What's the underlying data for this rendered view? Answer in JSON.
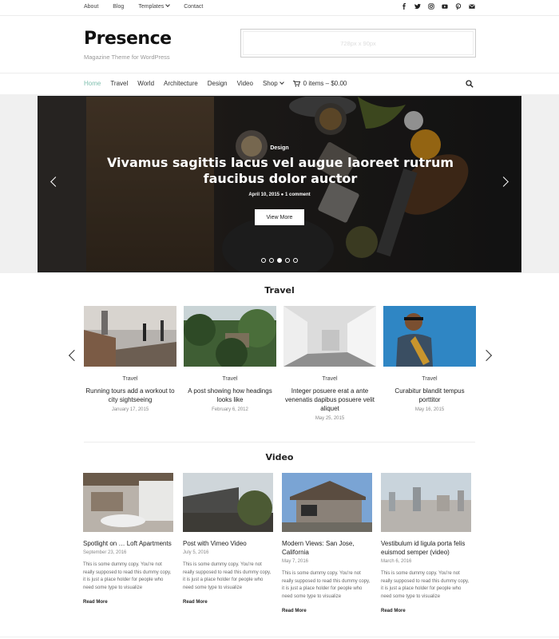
{
  "topbar": {
    "links": [
      "About",
      "Blog",
      "Templates",
      "Contact"
    ],
    "social_icons": [
      "facebook-icon",
      "twitter-icon",
      "instagram-icon",
      "youtube-icon",
      "pinterest-icon",
      "email-icon"
    ]
  },
  "header": {
    "logo": "Presence",
    "tagline": "Magazine Theme for WordPress",
    "ad_text": "728px x 90px"
  },
  "nav": {
    "items": [
      "Home",
      "Travel",
      "World",
      "Architecture",
      "Design",
      "Video",
      "Shop"
    ],
    "active": "Home",
    "cart": "0 items – $0.00"
  },
  "hero": {
    "category": "Design",
    "title": "Vivamus sagittis lacus vel augue laoreet rutrum faucibus dolor auctor",
    "meta": "April 10, 2015  ●  1 comment",
    "button": "View More",
    "slides_total": 5,
    "slide_active": 3
  },
  "travel": {
    "heading": "Travel",
    "cards": [
      {
        "category": "Travel",
        "title": "Running tours add a workout to city sightseeing",
        "date": "January 17, 2015"
      },
      {
        "category": "Travel",
        "title": "A post showing how headings looks like",
        "date": "February 6, 2012"
      },
      {
        "category": "Travel",
        "title": "Integer posuere erat a ante venenatis dapibus posuere velit aliquet",
        "date": "May 25, 2015"
      },
      {
        "category": "Travel",
        "title": "Curabitur blandit tempus porttitor",
        "date": "May 16, 2015"
      }
    ]
  },
  "video": {
    "heading": "Video",
    "cards": [
      {
        "title": "Spotlight on … Loft Apartments",
        "date": "September 23, 2016",
        "excerpt": "This is some dummy copy. You're not really supposed to read this dummy copy, it is just a place holder for people who need some type to visualize",
        "more": "Read More"
      },
      {
        "title": "Post with Vimeo Video",
        "date": "July 5, 2016",
        "excerpt": "This is some dummy copy. You're not really supposed to read this dummy copy, it is just a place holder for people who need some type to visualize",
        "more": "Read More"
      },
      {
        "title": "Modern Views: San Jose, California",
        "date": "May 7, 2016",
        "excerpt": "This is some dummy copy. You're not really supposed to read this dummy copy, it is just a place holder for people who need some type to visualize",
        "more": "Read More"
      },
      {
        "title": "Vestibulum id ligula porta felis euismod semper (video)",
        "date": "March 6, 2016",
        "excerpt": "This is some dummy copy. You're not really supposed to read this dummy copy, it is just a place holder for people who need some type to visualize",
        "more": "Read More"
      }
    ]
  },
  "colors": {
    "accent": "#7fbfae",
    "text": "#222222",
    "muted": "#888888"
  }
}
